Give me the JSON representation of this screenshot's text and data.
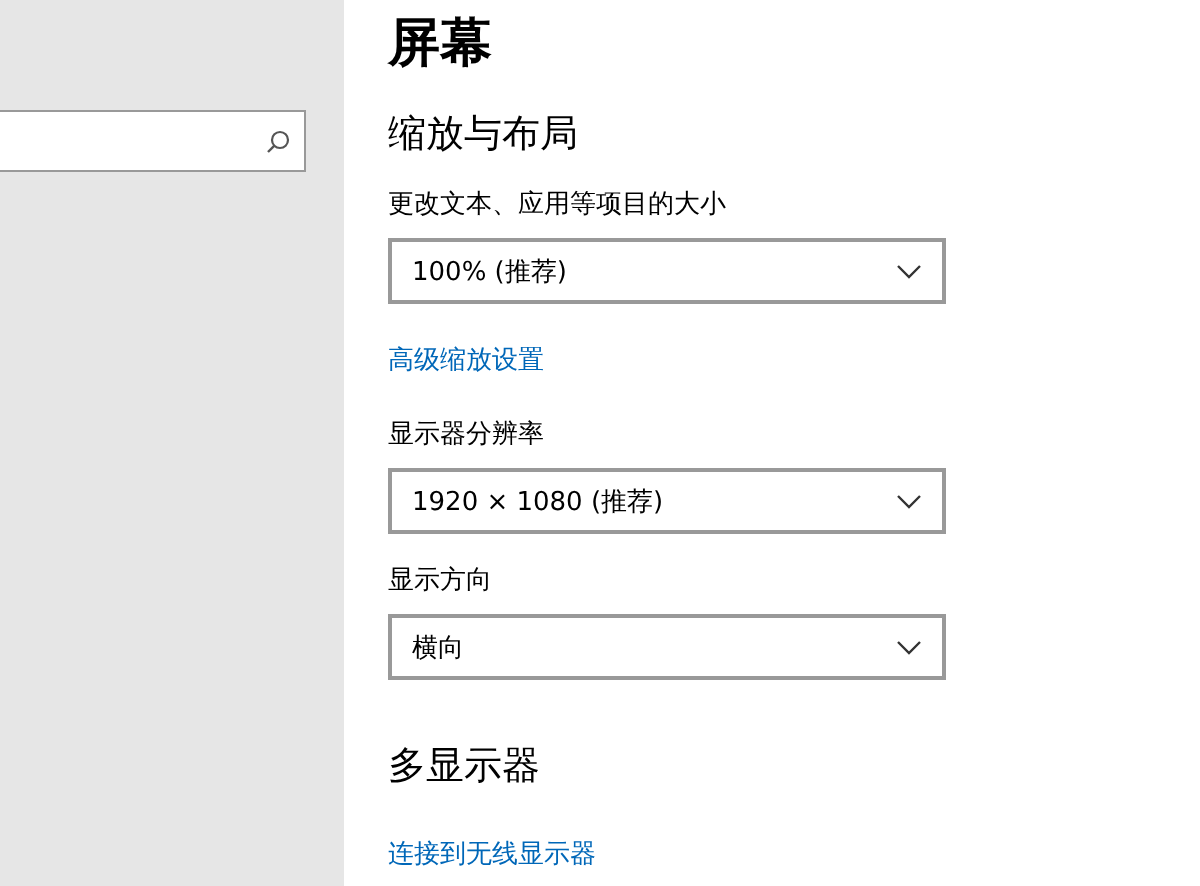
{
  "page": {
    "title": "屏幕"
  },
  "sections": [
    {
      "heading": "缩放与布局",
      "items": [
        {
          "kind": "dropdown",
          "label": "更改文本、应用等项目的大小",
          "value": "100% (推荐)"
        },
        {
          "kind": "link",
          "text": "高级缩放设置"
        },
        {
          "kind": "dropdown",
          "label": "显示器分辨率",
          "value": "1920 × 1080 (推荐)"
        },
        {
          "kind": "dropdown",
          "label": "显示方向",
          "value": "横向"
        }
      ]
    },
    {
      "heading": "多显示器",
      "items": [
        {
          "kind": "link",
          "text": "连接到无线显示器"
        }
      ]
    }
  ]
}
